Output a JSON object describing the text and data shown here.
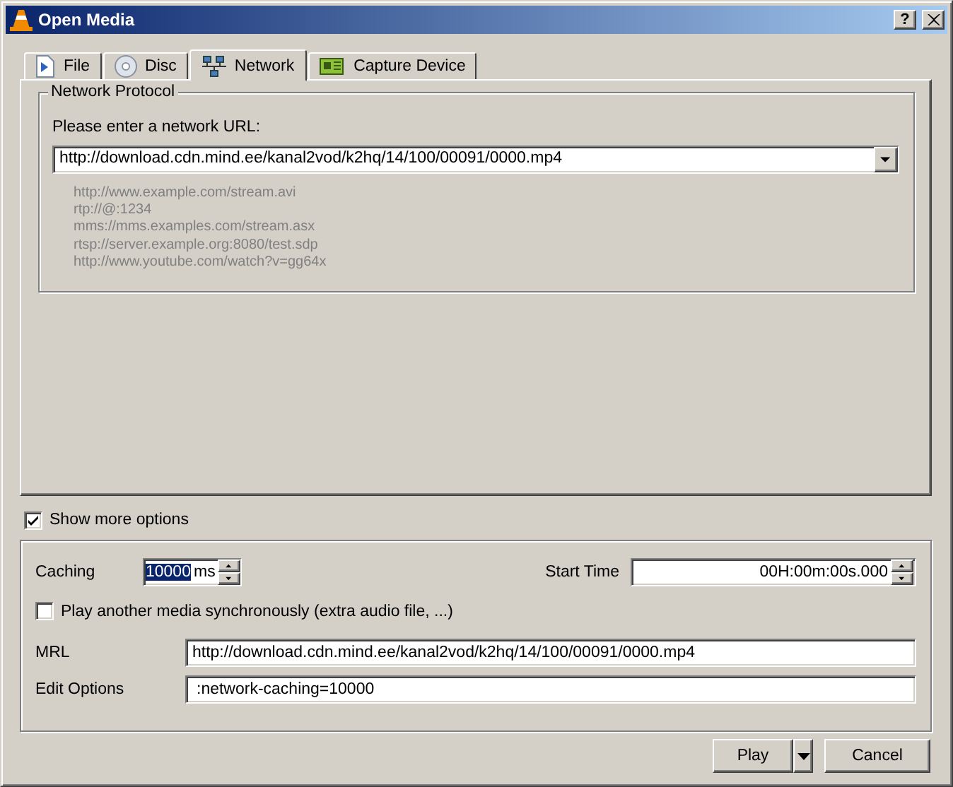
{
  "window": {
    "title": "Open Media",
    "help_button": "?"
  },
  "tabs": [
    {
      "label": "File",
      "kind": "file",
      "selected": false
    },
    {
      "label": "Disc",
      "kind": "disc",
      "selected": false
    },
    {
      "label": "Network",
      "kind": "network",
      "selected": true
    },
    {
      "label": "Capture Device",
      "kind": "capture",
      "selected": false
    }
  ],
  "network": {
    "group_title": "Network Protocol",
    "prompt": "Please enter a network URL:",
    "url": "http://download.cdn.mind.ee/kanal2vod/k2hq/14/100/00091/0000.mp4",
    "examples": [
      "http://www.example.com/stream.avi",
      "rtp://@:1234",
      "mms://mms.examples.com/stream.asx",
      "rtsp://server.example.org:8080/test.sdp",
      "http://www.youtube.com/watch?v=gg64x"
    ]
  },
  "show_more_options": {
    "label": "Show more options",
    "checked": true
  },
  "options": {
    "caching_label": "Caching",
    "caching_value": "10000",
    "caching_value_selected": true,
    "caching_unit": "ms",
    "start_time_label": "Start Time",
    "start_time_value": "00H:00m:00s.000",
    "sync": {
      "label": "Play another media synchronously (extra audio file, ...)",
      "checked": false
    },
    "mrl_label": "MRL",
    "mrl": "http://download.cdn.mind.ee/kanal2vod/k2hq/14/100/00091/0000.mp4",
    "edit_options_label": "Edit Options",
    "edit_options": ":network-caching=10000"
  },
  "buttons": {
    "play": "Play",
    "cancel": "Cancel"
  }
}
